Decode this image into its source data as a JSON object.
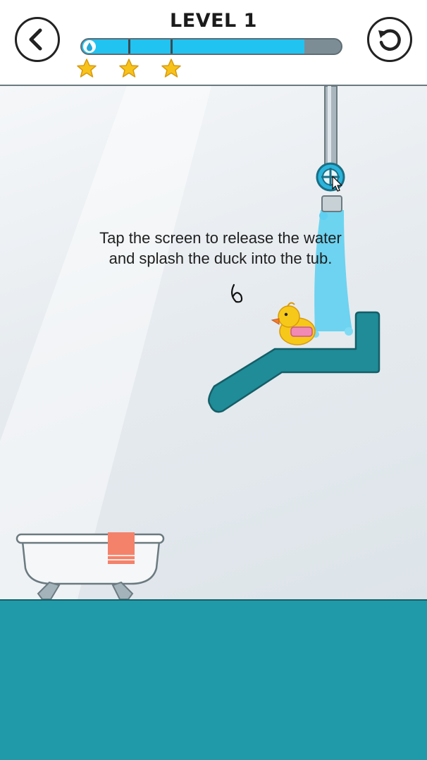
{
  "header": {
    "title": "LEVEL 1",
    "back_icon": "chevron-left-icon",
    "restart_icon": "restart-icon",
    "progress": {
      "fill_fraction": 0.86,
      "tick_count": 2,
      "color": "#21c3f0",
      "track_color": "#7d8d96"
    },
    "stars": {
      "earned": 3,
      "total": 3,
      "color": "#f7c31b"
    }
  },
  "scene": {
    "instruction_line1": "Tap the screen to release the water",
    "instruction_line2": "and splash the duck into the tub.",
    "colors": {
      "ramp": "#1f8c98",
      "water": "#5fd0f0",
      "floor": "#209aa9",
      "duck": "#f6c81a",
      "towel": "#f4826b"
    }
  }
}
